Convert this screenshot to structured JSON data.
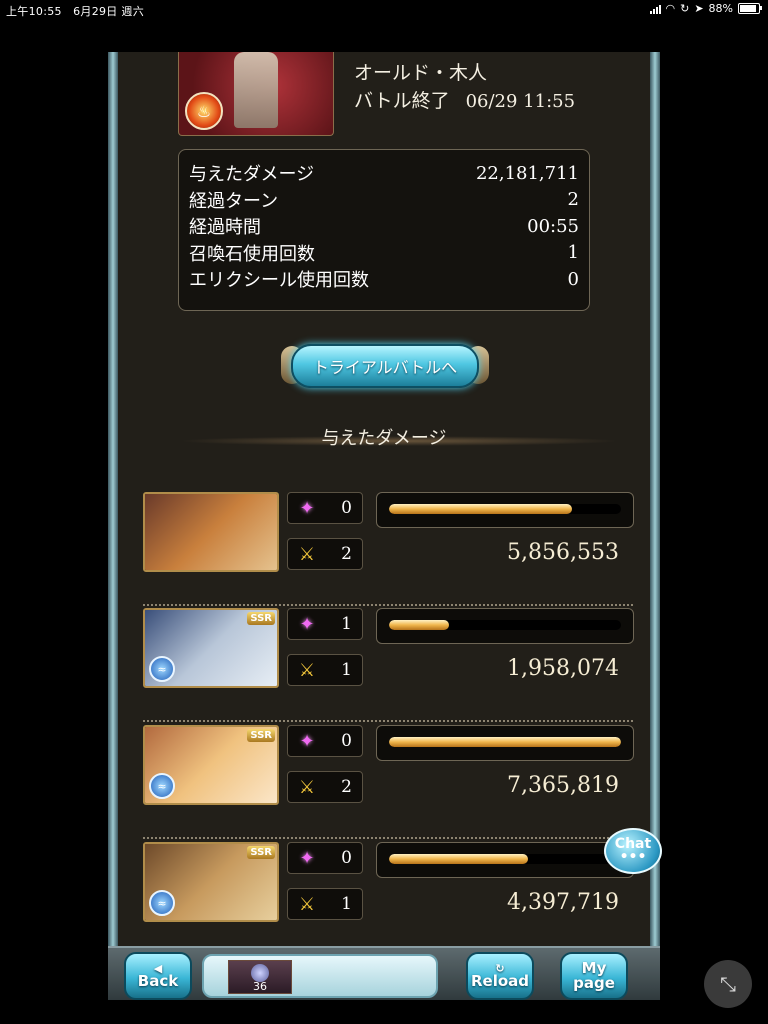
{
  "status_bar": {
    "time_date": "上午10:55　6月29日 週六",
    "battery": "88%",
    "icons": [
      "signal-icon",
      "wifi-icon",
      "lock-rotation-icon",
      "location-icon",
      "battery-icon"
    ]
  },
  "boss": {
    "name": "オールド・木人",
    "status": "バトル終了",
    "datetime": "06/29 11:55",
    "element_icon": "fire-element-icon"
  },
  "stats": [
    {
      "label": "与えたダメージ",
      "value": "22,181,711"
    },
    {
      "label": "経過ターン",
      "value": "2"
    },
    {
      "label": "経過時間",
      "value": "00:55"
    },
    {
      "label": "召喚石使用回数",
      "value": "1"
    },
    {
      "label": "エリクシール使用回数",
      "value": "0"
    }
  ],
  "trial_button": "トライアルバトルへ",
  "section_title": "与えたダメージ",
  "members": [
    {
      "ssr": "",
      "element_icon": "",
      "skills": "0",
      "attacks": "2",
      "damage": "5,856,553",
      "damage_ratio": 0.79,
      "art_colors": [
        "#6a3a2a",
        "#c9803d",
        "#e5c28e"
      ]
    },
    {
      "ssr": "SSR",
      "element_icon": "water-element-icon",
      "skills": "1",
      "attacks": "1",
      "damage": "1,958,074",
      "damage_ratio": 0.26,
      "art_colors": [
        "#3a4f7a",
        "#b8c6d8",
        "#e7eef5"
      ]
    },
    {
      "ssr": "SSR",
      "element_icon": "water-element-icon",
      "skills": "0",
      "attacks": "2",
      "damage": "7,365,819",
      "damage_ratio": 1.0,
      "art_colors": [
        "#b26a3f",
        "#f0c27f",
        "#fbe6c8"
      ]
    },
    {
      "ssr": "SSR",
      "element_icon": "water-element-icon",
      "skills": "0",
      "attacks": "1",
      "damage": "4,397,719",
      "damage_ratio": 0.6,
      "art_colors": [
        "#6e4a2a",
        "#c79a5e",
        "#e7cf9d"
      ]
    }
  ],
  "nav": {
    "back_label": "Back",
    "reload_label": "Reload",
    "mypage_line1": "My",
    "mypage_line2": "page",
    "ap_level": "36"
  },
  "chat_label": "Chat",
  "colors": {
    "accent_cyan": "#4fc7e2",
    "bar_gold": "#f0b64c",
    "panel_bg": "#221f19"
  }
}
